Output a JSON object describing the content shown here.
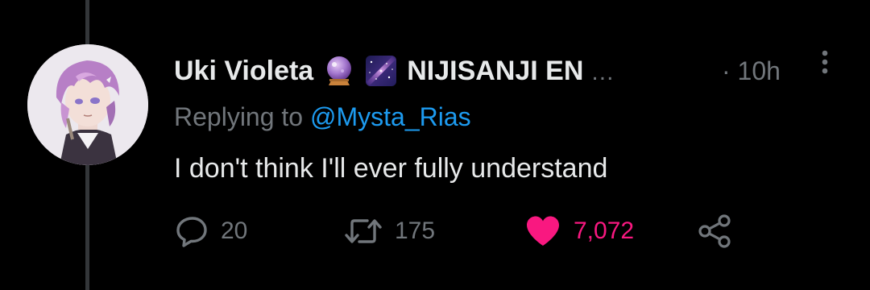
{
  "tweet": {
    "display_name": "Uki Violeta",
    "emoji_1": "🔮",
    "emoji_2": "🌌",
    "affiliation": "NIJISANJI EN",
    "truncation": "...",
    "timestamp": "· 10h",
    "replying_prefix": "Replying to",
    "replying_handle": "@Mysta_Rias",
    "text": "I don't think I'll ever fully understand"
  },
  "actions": {
    "replies": "20",
    "retweets": "175",
    "likes": "7,072"
  },
  "icons": {
    "reply": "reply-bubble-icon",
    "retweet": "retweet-icon",
    "like": "heart-icon",
    "share": "share-icon",
    "more": "more-vertical-icon",
    "emoji_1": "crystal-ball-icon",
    "emoji_2": "milky-way-icon"
  },
  "colors": {
    "background": "#000000",
    "text_primary": "#e7e9ea",
    "text_secondary": "#71767b",
    "link": "#1d9bf0",
    "like": "#f91880",
    "thread_line": "#333639"
  }
}
